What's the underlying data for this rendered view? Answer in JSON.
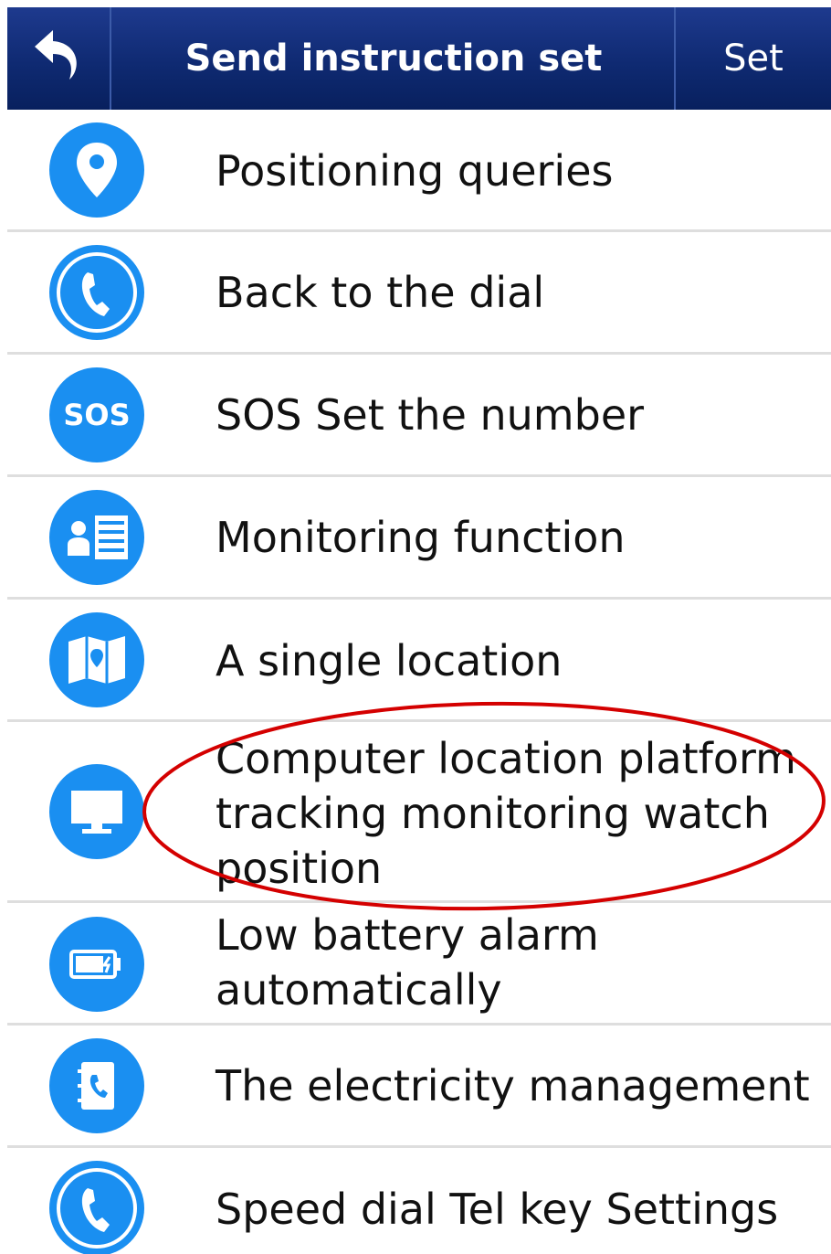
{
  "header": {
    "back_icon": "back-arrow-icon",
    "title": "Send instruction set",
    "set_label": "Set",
    "gradient_top": "#1e3a8e",
    "gradient_bottom": "#08205e"
  },
  "accent_color": "#1a8ff1",
  "annotation_color": "#d40000",
  "items": [
    {
      "label": "Positioning queries",
      "icon": "location-pin-icon"
    },
    {
      "label": "Back to the dial",
      "icon": "phone-icon"
    },
    {
      "label": "SOS Set the number",
      "icon": "sos-icon",
      "icon_text": "SOS"
    },
    {
      "label": "Monitoring function",
      "icon": "contact-list-icon"
    },
    {
      "label": "A single location",
      "icon": "map-icon"
    },
    {
      "label": "Computer location platform tracking monitoring watch position",
      "icon": "monitor-icon"
    },
    {
      "label": "Low battery alarm automatically",
      "icon": "battery-icon"
    },
    {
      "label": "The electricity management",
      "icon": "phone-book-icon"
    },
    {
      "label": "Speed dial Tel key Settings",
      "icon": "phone-icon"
    }
  ]
}
